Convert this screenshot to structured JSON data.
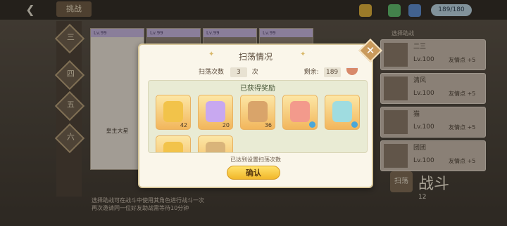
{
  "background": {
    "topbar": {
      "back_icon": "back-arrow-icon",
      "title": "挑战"
    },
    "stamina": "189/180",
    "sidebar": [
      "三",
      "四",
      "五",
      "六"
    ],
    "cards": [
      {
        "lv": "Lv.99",
        "name": "皇主大星"
      },
      {
        "lv": "Lv.99"
      },
      {
        "lv": "Lv.99"
      },
      {
        "lv": "Lv.99"
      }
    ],
    "friends_header": "选择助战",
    "friends": [
      {
        "name": "二三",
        "level": "Lv.100",
        "points": "友情点 +5"
      },
      {
        "name": "清风",
        "level": "Lv.100",
        "points": "友情点 +5"
      },
      {
        "name": "猫",
        "level": "Lv.100",
        "points": "友情点 +5"
      },
      {
        "name": "团团",
        "level": "Lv.100",
        "points": "友情点 +5"
      }
    ],
    "sweep_button": "扫荡",
    "start_button": "战斗",
    "start_cost": "12",
    "tip": "选择助战可在战斗中使用其角色进行战斗一次\n再次邀请同一位好友助战需等待10分钟"
  },
  "dialog": {
    "title": "扫荡情况",
    "sweep_count_label": "扫荡次数",
    "sweep_count": "3",
    "times_unit": "次",
    "remaining_label": "剩余:",
    "remaining_value": "189",
    "reward_title": "已获得奖励",
    "items": [
      {
        "icon": "gold-crystal-icon",
        "count": "42",
        "color": "#f2c34a"
      },
      {
        "icon": "rainbow-crystal-icon",
        "count": "20",
        "color": "#c8a8f0"
      },
      {
        "icon": "coin-icon",
        "count": "36",
        "color": "#d9a46a"
      },
      {
        "icon": "character-icon",
        "count": "",
        "color": "#f39a8c"
      },
      {
        "icon": "character-icon",
        "count": "",
        "color": "#9fdce0"
      },
      {
        "icon": "gold-crystal-icon",
        "count": "",
        "color": "#f2c34a"
      },
      {
        "icon": "coin-icon",
        "count": "",
        "color": "#d9b47a"
      }
    ],
    "reached_text": "已达到设置扫荡次数",
    "confirm_label": "确认",
    "close_icon": "close-icon"
  }
}
